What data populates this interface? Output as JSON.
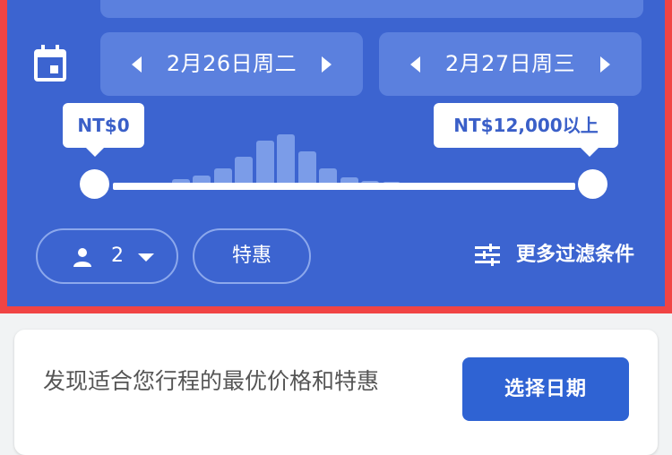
{
  "colors": {
    "panel": "#3c64d0",
    "accent": "#2f63d3",
    "border_highlight": "#f04444"
  },
  "dates": {
    "start": "2月26日周二",
    "end": "2月27日周三"
  },
  "price": {
    "min_label": "NT$0",
    "max_label": "NT$12,000以上",
    "histogram": [
      0,
      6,
      10,
      18,
      30,
      48,
      55,
      36,
      18,
      8,
      4,
      3
    ]
  },
  "guests": {
    "count": "2"
  },
  "deals_label": "特惠",
  "more_filters_label": "更多过滤条件",
  "promo": {
    "message": "发现适合您行程的最优价格和特惠",
    "button_label": "选择日期"
  },
  "icons": [
    "calendar-icon",
    "arrow-left-icon",
    "arrow-right-icon",
    "person-icon",
    "caret-down-icon",
    "filter-icon"
  ]
}
